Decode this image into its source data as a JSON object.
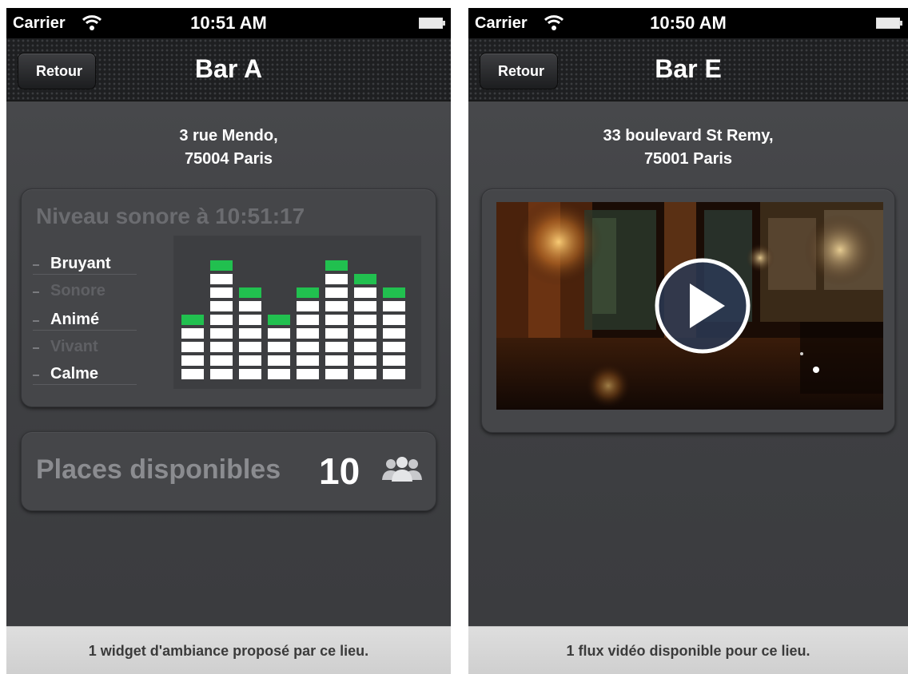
{
  "left_screen": {
    "status_bar": {
      "carrier": "Carrier",
      "time": "10:51 AM"
    },
    "nav": {
      "back_label": "Retour",
      "title": "Bar A"
    },
    "address": {
      "line1": "3 rue Mendo,",
      "line2": "75004 Paris"
    },
    "sound_widget": {
      "title": "Niveau sonore à 10:51:17",
      "levels": [
        "Bruyant",
        "Sonore",
        "Animé",
        "Vivant",
        "Calme"
      ],
      "active_levels": [
        "Bruyant",
        "Animé",
        "Calme"
      ],
      "bar_segments": [
        5,
        9,
        7,
        5,
        7,
        9,
        8,
        7
      ],
      "colors": {
        "peak": "#21c04f",
        "segment": "#ffffff"
      }
    },
    "places": {
      "label": "Places disponibles",
      "count": "10",
      "icon": "people-icon"
    },
    "footer": "1 widget d'ambiance proposé par ce lieu."
  },
  "right_screen": {
    "status_bar": {
      "carrier": "Carrier",
      "time": "10:50 AM"
    },
    "nav": {
      "back_label": "Retour",
      "title": "Bar E"
    },
    "address": {
      "line1": "33 boulevard St Remy,",
      "line2": "75001 Paris"
    },
    "video": {
      "icon": "play-icon"
    },
    "footer": "1 flux vidéo disponible pour ce lieu."
  }
}
